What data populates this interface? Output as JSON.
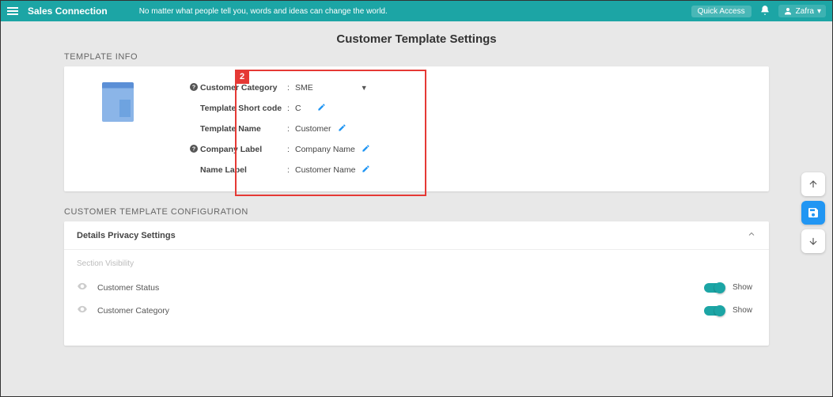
{
  "header": {
    "brand": "Sales Connection",
    "tagline": "No matter what people tell you, words and ideas can change the world.",
    "quick_access": "Quick Access",
    "user": "Zafra"
  },
  "page_title": "Customer Template Settings",
  "template_info": {
    "section_label": "TEMPLATE INFO",
    "badge": "2",
    "rows": {
      "category": {
        "label": "Customer Category",
        "value": "SME"
      },
      "short_code": {
        "label": "Template Short code",
        "value": "C"
      },
      "name": {
        "label": "Template Name",
        "value": "Customer"
      },
      "company": {
        "label": "Company Label",
        "value": "Company Name"
      },
      "name_label": {
        "label": "Name Label",
        "value": "Customer Name"
      }
    }
  },
  "config": {
    "section_label": "CUSTOMER TEMPLATE CONFIGURATION",
    "panel_title": "Details Privacy Settings",
    "sub_label": "Section Visibility",
    "rows": [
      {
        "name": "Customer Status",
        "state": "Show"
      },
      {
        "name": "Customer Category",
        "state": "Show"
      }
    ]
  }
}
